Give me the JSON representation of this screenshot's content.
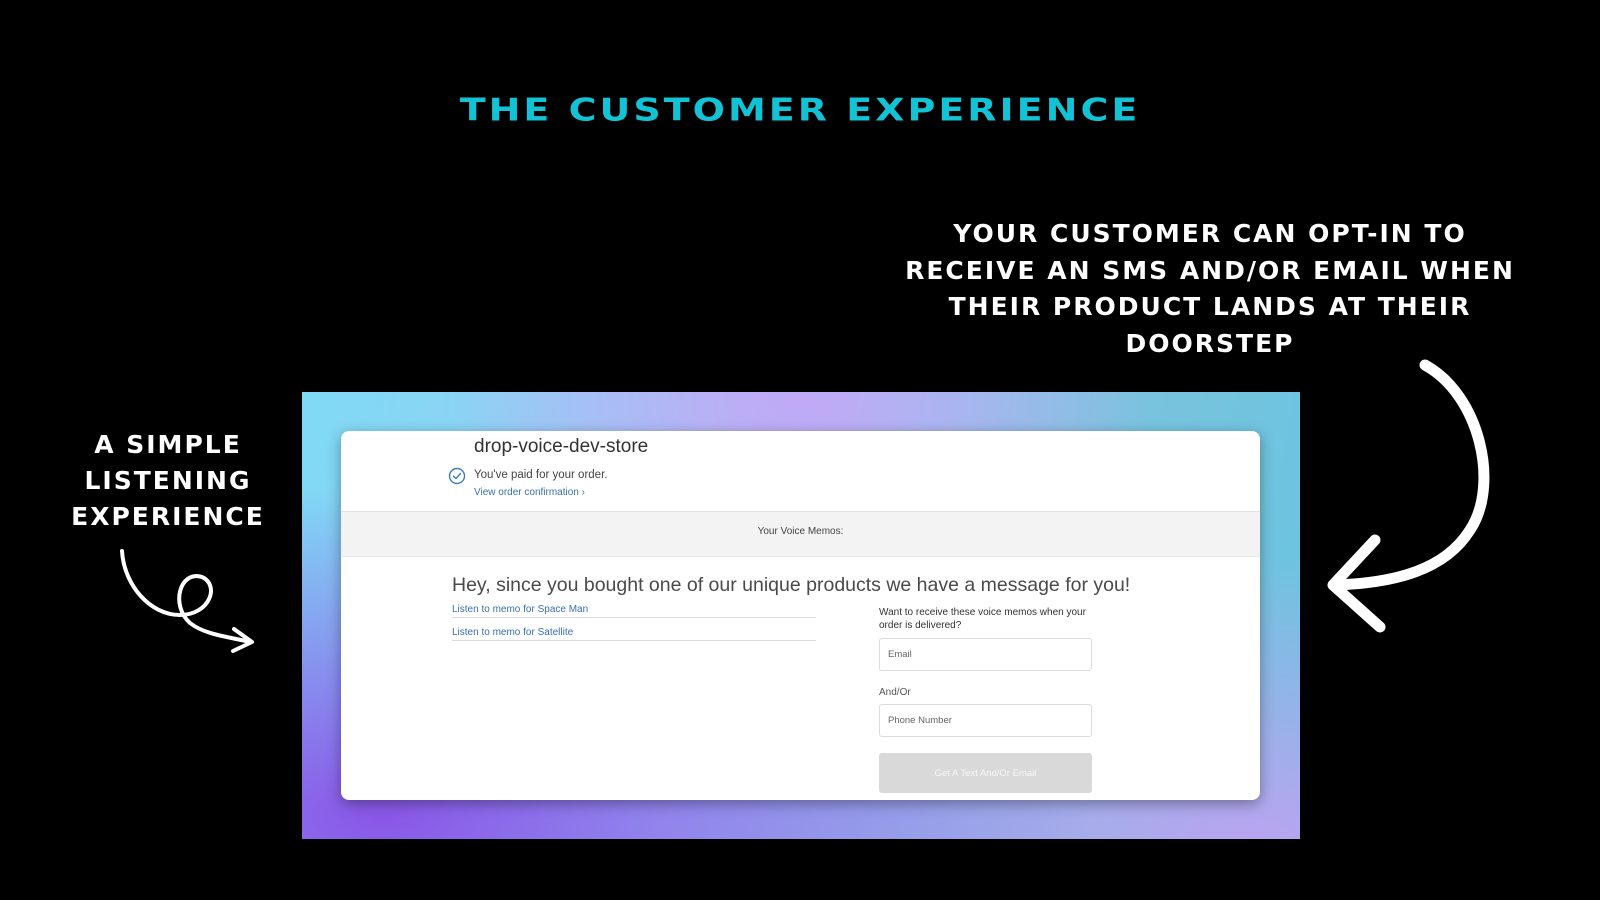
{
  "slide": {
    "headline": "THE CUSTOMER EXPERIENCE",
    "callout_right": "YOUR CUSTOMER CAN OPT-IN TO RECEIVE AN SMS AND/OR EMAIL WHEN THEIR PRODUCT LANDS AT THEIR DOORSTEP",
    "callout_left": "A SIMPLE LISTENING EXPERIENCE"
  },
  "page": {
    "store_name": "drop-voice-dev-store",
    "paid_text": "You've paid for your order.",
    "confirmation_link": "View order confirmation ›",
    "memos_label": "Your Voice Memos:",
    "message": "Hey, since you bought one of our unique products we have a message for you!",
    "memo_links": [
      "Listen to memo for Space Man",
      "Listen to memo for Satellite"
    ],
    "optin": {
      "label": "Want to receive these voice memos when your order is delivered?",
      "email_placeholder": "Email",
      "andor": "And/Or",
      "phone_placeholder": "Phone Number",
      "button": "Get A Text And/Or Email"
    }
  },
  "colors": {
    "headline": "#12c3d6",
    "link": "#3a6fb0",
    "background": "#000000"
  },
  "icons": {
    "check": "check-circle-icon",
    "arrow_left": "curly-arrow-right-icon",
    "arrow_right": "curved-arrow-left-icon"
  }
}
